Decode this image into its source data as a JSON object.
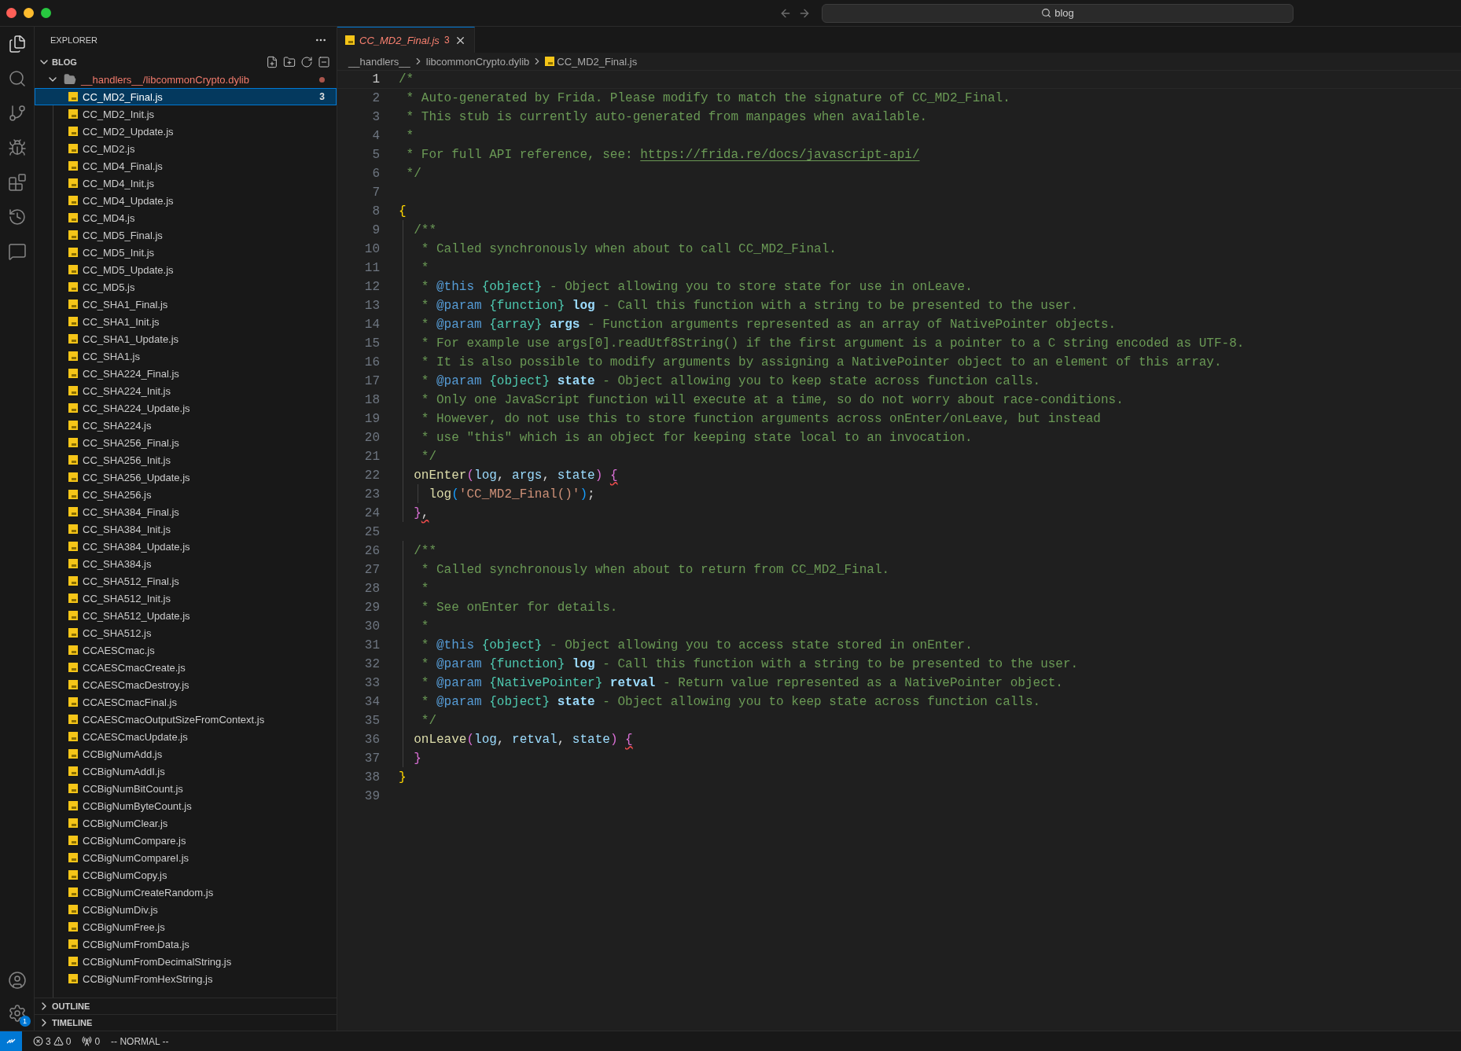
{
  "title_bar": {
    "search": "blog"
  },
  "activity_bar": {
    "top": [
      {
        "kind": "files",
        "selected": true
      },
      {
        "kind": "search",
        "selected": false
      },
      {
        "kind": "branch",
        "selected": false
      },
      {
        "kind": "debug",
        "selected": false
      },
      {
        "kind": "extensions",
        "selected": false
      },
      {
        "kind": "history",
        "selected": false
      },
      {
        "kind": "chat",
        "selected": false
      }
    ],
    "bottom": [
      {
        "kind": "account"
      },
      {
        "kind": "settings",
        "badge": "1"
      }
    ]
  },
  "sidebar": {
    "title": "EXPLORER",
    "workspace": {
      "label": "BLOG",
      "expanded": true
    },
    "folder": {
      "label": "__handlers__/libcommonCrypto.dylib",
      "expanded": true,
      "has_problems": true
    },
    "files": [
      {
        "name": "CC_MD2_Final.js",
        "selected": true,
        "badge": "3"
      },
      {
        "name": "CC_MD2_Init.js",
        "selected": false
      },
      {
        "name": "CC_MD2_Update.js",
        "selected": false
      },
      {
        "name": "CC_MD2.js",
        "selected": false
      },
      {
        "name": "CC_MD4_Final.js",
        "selected": false
      },
      {
        "name": "CC_MD4_Init.js",
        "selected": false
      },
      {
        "name": "CC_MD4_Update.js",
        "selected": false
      },
      {
        "name": "CC_MD4.js",
        "selected": false
      },
      {
        "name": "CC_MD5_Final.js",
        "selected": false
      },
      {
        "name": "CC_MD5_Init.js",
        "selected": false
      },
      {
        "name": "CC_MD5_Update.js",
        "selected": false
      },
      {
        "name": "CC_MD5.js",
        "selected": false
      },
      {
        "name": "CC_SHA1_Final.js",
        "selected": false
      },
      {
        "name": "CC_SHA1_Init.js",
        "selected": false
      },
      {
        "name": "CC_SHA1_Update.js",
        "selected": false
      },
      {
        "name": "CC_SHA1.js",
        "selected": false
      },
      {
        "name": "CC_SHA224_Final.js",
        "selected": false
      },
      {
        "name": "CC_SHA224_Init.js",
        "selected": false
      },
      {
        "name": "CC_SHA224_Update.js",
        "selected": false
      },
      {
        "name": "CC_SHA224.js",
        "selected": false
      },
      {
        "name": "CC_SHA256_Final.js",
        "selected": false
      },
      {
        "name": "CC_SHA256_Init.js",
        "selected": false
      },
      {
        "name": "CC_SHA256_Update.js",
        "selected": false
      },
      {
        "name": "CC_SHA256.js",
        "selected": false
      },
      {
        "name": "CC_SHA384_Final.js",
        "selected": false
      },
      {
        "name": "CC_SHA384_Init.js",
        "selected": false
      },
      {
        "name": "CC_SHA384_Update.js",
        "selected": false
      },
      {
        "name": "CC_SHA384.js",
        "selected": false
      },
      {
        "name": "CC_SHA512_Final.js",
        "selected": false
      },
      {
        "name": "CC_SHA512_Init.js",
        "selected": false
      },
      {
        "name": "CC_SHA512_Update.js",
        "selected": false
      },
      {
        "name": "CC_SHA512.js",
        "selected": false
      },
      {
        "name": "CCAESCmac.js",
        "selected": false
      },
      {
        "name": "CCAESCmacCreate.js",
        "selected": false
      },
      {
        "name": "CCAESCmacDestroy.js",
        "selected": false
      },
      {
        "name": "CCAESCmacFinal.js",
        "selected": false
      },
      {
        "name": "CCAESCmacOutputSizeFromContext.js",
        "selected": false
      },
      {
        "name": "CCAESCmacUpdate.js",
        "selected": false
      },
      {
        "name": "CCBigNumAdd.js",
        "selected": false
      },
      {
        "name": "CCBigNumAddI.js",
        "selected": false
      },
      {
        "name": "CCBigNumBitCount.js",
        "selected": false
      },
      {
        "name": "CCBigNumByteCount.js",
        "selected": false
      },
      {
        "name": "CCBigNumClear.js",
        "selected": false
      },
      {
        "name": "CCBigNumCompare.js",
        "selected": false
      },
      {
        "name": "CCBigNumCompareI.js",
        "selected": false
      },
      {
        "name": "CCBigNumCopy.js",
        "selected": false
      },
      {
        "name": "CCBigNumCreateRandom.js",
        "selected": false
      },
      {
        "name": "CCBigNumDiv.js",
        "selected": false
      },
      {
        "name": "CCBigNumFree.js",
        "selected": false
      },
      {
        "name": "CCBigNumFromData.js",
        "selected": false
      },
      {
        "name": "CCBigNumFromDecimalString.js",
        "selected": false
      },
      {
        "name": "CCBigNumFromHexString.js",
        "selected": false
      }
    ],
    "sections": [
      {
        "label": "OUTLINE",
        "expanded": false
      },
      {
        "label": "TIMELINE",
        "expanded": false
      }
    ]
  },
  "tabs": [
    {
      "label": "CC_MD2_Final.js",
      "problems": "3",
      "selected": true,
      "preview": true
    }
  ],
  "breadcrumbs": [
    "__handlers__",
    "libcommonCrypto.dylib",
    "CC_MD2_Final.js"
  ],
  "editor": {
    "lines": [
      {
        "number": "1",
        "current": true,
        "tokens": [
          {
            "kind": "comment",
            "text": "/*"
          }
        ]
      },
      {
        "number": "2",
        "current": false,
        "tokens": [
          {
            "kind": "comment",
            "text": " * Auto-generated by Frida. Please modify to match the signature of CC_MD2_Final."
          }
        ]
      },
      {
        "number": "3",
        "current": false,
        "tokens": [
          {
            "kind": "comment",
            "text": " * This stub is currently auto-generated from manpages when available."
          }
        ]
      },
      {
        "number": "4",
        "current": false,
        "tokens": [
          {
            "kind": "comment",
            "text": " *"
          }
        ]
      },
      {
        "number": "5",
        "current": false,
        "tokens": [
          {
            "kind": "comment",
            "text": " * For full API reference, see: "
          },
          {
            "kind": "link",
            "text": "https://frida.re/docs/javascript-api/"
          }
        ]
      },
      {
        "number": "6",
        "current": false,
        "tokens": [
          {
            "kind": "comment",
            "text": " */"
          }
        ]
      },
      {
        "number": "7",
        "current": false
      },
      {
        "number": "8",
        "current": false,
        "tokens": [
          {
            "kind": "brace",
            "text": "{"
          }
        ]
      },
      {
        "number": "9",
        "current": false,
        "tokens": [
          {
            "kind": "comment",
            "text": "  /**"
          }
        ]
      },
      {
        "number": "10",
        "current": false,
        "tokens": [
          {
            "kind": "comment",
            "text": "   * Called synchronously when about to call CC_MD2_Final."
          }
        ]
      },
      {
        "number": "11",
        "current": false,
        "tokens": [
          {
            "kind": "comment",
            "text": "   *"
          }
        ]
      },
      {
        "number": "12",
        "current": false,
        "tokens": [
          {
            "kind": "comment",
            "text": "   * "
          },
          {
            "kind": "tag",
            "text": "@this"
          },
          {
            "kind": "type",
            "text": " {object}"
          },
          {
            "kind": "comment",
            "text": " - Object allowing you to store state for use in onLeave."
          }
        ]
      },
      {
        "number": "13",
        "current": false,
        "tokens": [
          {
            "kind": "comment",
            "text": "   * "
          },
          {
            "kind": "tag",
            "text": "@param"
          },
          {
            "kind": "type",
            "text": " {function}"
          },
          {
            "kind": "name",
            "text": " log"
          },
          {
            "kind": "comment",
            "text": " - Call this function with a string to be presented to the user."
          }
        ]
      },
      {
        "number": "14",
        "current": false,
        "tokens": [
          {
            "kind": "comment",
            "text": "   * "
          },
          {
            "kind": "tag",
            "text": "@param"
          },
          {
            "kind": "type",
            "text": " {array}"
          },
          {
            "kind": "name",
            "text": " args"
          },
          {
            "kind": "comment",
            "text": " - Function arguments represented as an array of NativePointer objects."
          }
        ]
      },
      {
        "number": "15",
        "current": false,
        "tokens": [
          {
            "kind": "comment",
            "text": "   * For example use args[0].readUtf8String() if the first argument is a pointer to a C string encoded as UTF-8."
          }
        ]
      },
      {
        "number": "16",
        "current": false,
        "tokens": [
          {
            "kind": "comment",
            "text": "   * It is also possible to modify arguments by assigning a NativePointer object to an element of this array."
          }
        ]
      },
      {
        "number": "17",
        "current": false,
        "tokens": [
          {
            "kind": "comment",
            "text": "   * "
          },
          {
            "kind": "tag",
            "text": "@param"
          },
          {
            "kind": "type",
            "text": " {object}"
          },
          {
            "kind": "name",
            "text": " state"
          },
          {
            "kind": "comment",
            "text": " - Object allowing you to keep state across function calls."
          }
        ]
      },
      {
        "number": "18",
        "current": false,
        "tokens": [
          {
            "kind": "comment",
            "text": "   * Only one JavaScript function will execute at a time, so do not worry about race-conditions."
          }
        ]
      },
      {
        "number": "19",
        "current": false,
        "tokens": [
          {
            "kind": "comment",
            "text": "   * However, do not use this to store function arguments across onEnter/onLeave, but instead"
          }
        ]
      },
      {
        "number": "20",
        "current": false,
        "tokens": [
          {
            "kind": "comment",
            "text": "   * use \"this\" which is an object for keeping state local to an invocation."
          }
        ]
      },
      {
        "number": "21",
        "current": false,
        "tokens": [
          {
            "kind": "comment",
            "text": "   */"
          }
        ]
      },
      {
        "number": "22",
        "current": false,
        "tokens": [
          {
            "kind": "function",
            "text": "  onEnter"
          },
          {
            "kind": "paren",
            "text": "("
          },
          {
            "kind": "variable",
            "text": "log"
          },
          {
            "kind": "plain",
            "text": ", "
          },
          {
            "kind": "variable",
            "text": "args"
          },
          {
            "kind": "plain",
            "text": ", "
          },
          {
            "kind": "variable",
            "text": "state"
          },
          {
            "kind": "paren",
            "text": ") "
          },
          {
            "kind": "paren",
            "text": "{",
            "squiggle": true
          }
        ]
      },
      {
        "number": "23",
        "current": false,
        "tokens": [
          {
            "kind": "function",
            "text": "    log"
          },
          {
            "kind": "paren2",
            "text": "("
          },
          {
            "kind": "string",
            "text": "'CC_MD2_Final()'"
          },
          {
            "kind": "paren2",
            "text": ")"
          },
          {
            "kind": "plain",
            "text": ";"
          }
        ]
      },
      {
        "number": "24",
        "current": false,
        "tokens": [
          {
            "kind": "paren",
            "text": "  }"
          },
          {
            "kind": "plain",
            "text": ",",
            "squiggle": true
          }
        ]
      },
      {
        "number": "25",
        "current": false
      },
      {
        "number": "26",
        "current": false,
        "tokens": [
          {
            "kind": "comment",
            "text": "  /**"
          }
        ]
      },
      {
        "number": "27",
        "current": false,
        "tokens": [
          {
            "kind": "comment",
            "text": "   * Called synchronously when about to return from CC_MD2_Final."
          }
        ]
      },
      {
        "number": "28",
        "current": false,
        "tokens": [
          {
            "kind": "comment",
            "text": "   *"
          }
        ]
      },
      {
        "number": "29",
        "current": false,
        "tokens": [
          {
            "kind": "comment",
            "text": "   * See onEnter for details."
          }
        ]
      },
      {
        "number": "30",
        "current": false,
        "tokens": [
          {
            "kind": "comment",
            "text": "   *"
          }
        ]
      },
      {
        "number": "31",
        "current": false,
        "tokens": [
          {
            "kind": "comment",
            "text": "   * "
          },
          {
            "kind": "tag",
            "text": "@this"
          },
          {
            "kind": "type",
            "text": " {object}"
          },
          {
            "kind": "comment",
            "text": " - Object allowing you to access state stored in onEnter."
          }
        ]
      },
      {
        "number": "32",
        "current": false,
        "tokens": [
          {
            "kind": "comment",
            "text": "   * "
          },
          {
            "kind": "tag",
            "text": "@param"
          },
          {
            "kind": "type",
            "text": " {function}"
          },
          {
            "kind": "name",
            "text": " log"
          },
          {
            "kind": "comment",
            "text": " - Call this function with a string to be presented to the user."
          }
        ]
      },
      {
        "number": "33",
        "current": false,
        "tokens": [
          {
            "kind": "comment",
            "text": "   * "
          },
          {
            "kind": "tag",
            "text": "@param"
          },
          {
            "kind": "type",
            "text": " {NativePointer}"
          },
          {
            "kind": "name",
            "text": " retval"
          },
          {
            "kind": "comment",
            "text": " - Return value represented as a NativePointer object."
          }
        ]
      },
      {
        "number": "34",
        "current": false,
        "tokens": [
          {
            "kind": "comment",
            "text": "   * "
          },
          {
            "kind": "tag",
            "text": "@param"
          },
          {
            "kind": "type",
            "text": " {object}"
          },
          {
            "kind": "name",
            "text": " state"
          },
          {
            "kind": "comment",
            "text": " - Object allowing you to keep state across function calls."
          }
        ]
      },
      {
        "number": "35",
        "current": false,
        "tokens": [
          {
            "kind": "comment",
            "text": "   */"
          }
        ]
      },
      {
        "number": "36",
        "current": false,
        "tokens": [
          {
            "kind": "function",
            "text": "  onLeave"
          },
          {
            "kind": "paren",
            "text": "("
          },
          {
            "kind": "variable",
            "text": "log"
          },
          {
            "kind": "plain",
            "text": ", "
          },
          {
            "kind": "variable",
            "text": "retval"
          },
          {
            "kind": "plain",
            "text": ", "
          },
          {
            "kind": "variable",
            "text": "state"
          },
          {
            "kind": "paren",
            "text": ") "
          },
          {
            "kind": "paren",
            "text": "{",
            "squiggle": true
          }
        ]
      },
      {
        "number": "37",
        "current": false,
        "tokens": [
          {
            "kind": "paren",
            "text": "  }"
          }
        ]
      },
      {
        "number": "38",
        "current": false,
        "tokens": [
          {
            "kind": "brace",
            "text": "}"
          }
        ]
      },
      {
        "number": "39",
        "current": false
      }
    ]
  },
  "status_bar": {
    "errors": "3",
    "warnings": "0",
    "ports": "0",
    "mode": "-- NORMAL --"
  }
}
